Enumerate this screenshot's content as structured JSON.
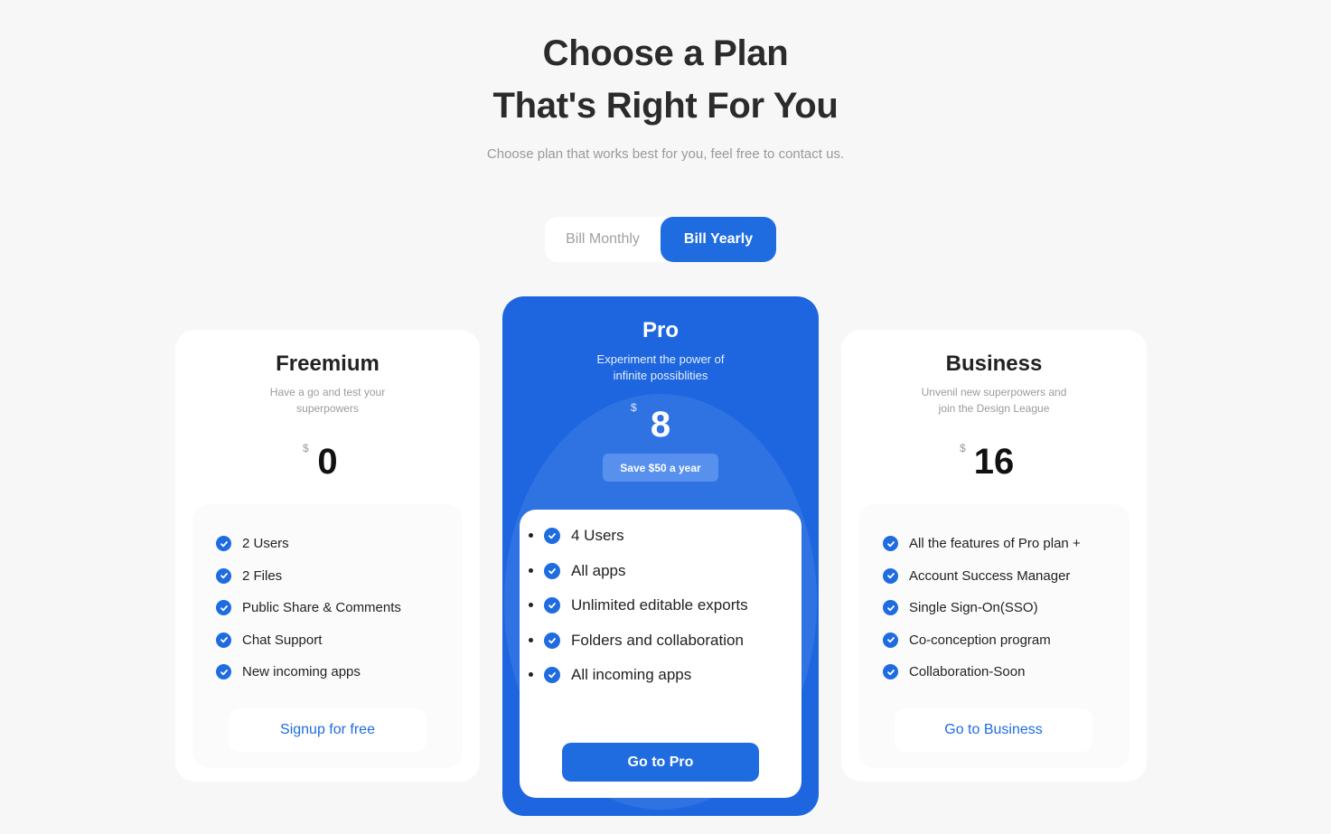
{
  "header": {
    "title_line1": "Choose a Plan",
    "title_line2": "That's Right For You",
    "subtitle": "Choose plan that works best for you, feel free to contact us."
  },
  "billing_toggle": {
    "monthly_label": "Bill Monthly",
    "yearly_label": "Bill Yearly",
    "selected": "yearly"
  },
  "plans": {
    "freemium": {
      "name": "Freemium",
      "description_line1": "Have a go and test your",
      "description_line2": "superpowers",
      "currency": "$",
      "price": "0",
      "features": [
        "2 Users",
        "2 Files",
        "Public Share & Comments",
        "Chat Support",
        "New incoming apps"
      ],
      "cta_label": "Signup for free"
    },
    "pro": {
      "name": "Pro",
      "description_line1": "Experiment the power of",
      "description_line2": "infinite possiblities",
      "currency": "$",
      "price": "8",
      "save_badge": "Save $50 a year",
      "features": [
        "4 Users",
        "All apps",
        "Unlimited editable exports",
        "Folders and collaboration",
        "All incoming apps"
      ],
      "cta_label": "Go to Pro"
    },
    "business": {
      "name": "Business",
      "description_line1": "Unvenil new superpowers and",
      "description_line2": "join the Design League",
      "currency": "$",
      "price": "16",
      "features": [
        "All the features of Pro plan +",
        "Account Success Manager",
        "Single Sign-On(SSO)",
        "Co-conception program",
        "Collaboration-Soon"
      ],
      "cta_label": "Go to Business"
    }
  },
  "colors": {
    "accent": "#1f6ce0",
    "page_bg": "#f7f7f7",
    "card_bg": "#ffffff"
  },
  "icons": {
    "feature_check": "check-circle-icon"
  }
}
